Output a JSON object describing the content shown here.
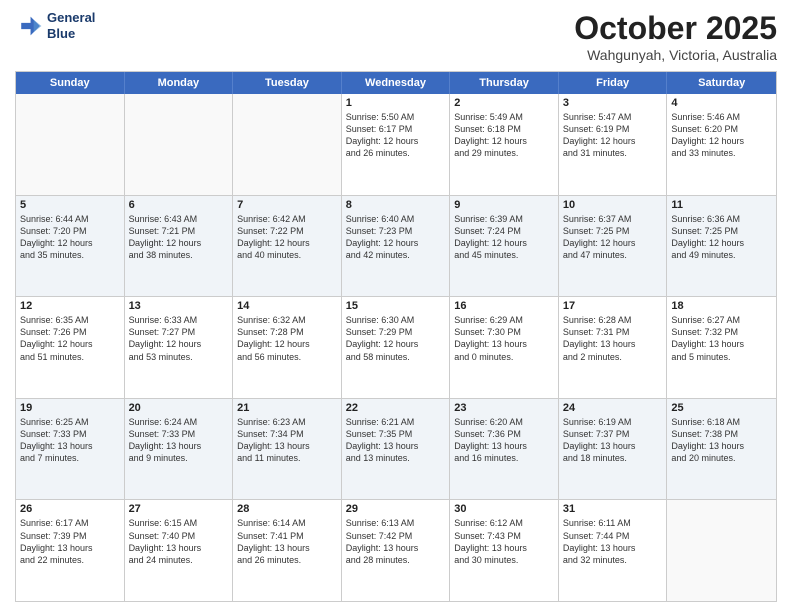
{
  "header": {
    "logo_line1": "General",
    "logo_line2": "Blue",
    "month": "October 2025",
    "location": "Wahgunyah, Victoria, Australia"
  },
  "day_headers": [
    "Sunday",
    "Monday",
    "Tuesday",
    "Wednesday",
    "Thursday",
    "Friday",
    "Saturday"
  ],
  "weeks": [
    {
      "alt": false,
      "days": [
        {
          "num": "",
          "info": ""
        },
        {
          "num": "",
          "info": ""
        },
        {
          "num": "",
          "info": ""
        },
        {
          "num": "1",
          "info": "Sunrise: 5:50 AM\nSunset: 6:17 PM\nDaylight: 12 hours\nand 26 minutes."
        },
        {
          "num": "2",
          "info": "Sunrise: 5:49 AM\nSunset: 6:18 PM\nDaylight: 12 hours\nand 29 minutes."
        },
        {
          "num": "3",
          "info": "Sunrise: 5:47 AM\nSunset: 6:19 PM\nDaylight: 12 hours\nand 31 minutes."
        },
        {
          "num": "4",
          "info": "Sunrise: 5:46 AM\nSunset: 6:20 PM\nDaylight: 12 hours\nand 33 minutes."
        }
      ]
    },
    {
      "alt": true,
      "days": [
        {
          "num": "5",
          "info": "Sunrise: 6:44 AM\nSunset: 7:20 PM\nDaylight: 12 hours\nand 35 minutes."
        },
        {
          "num": "6",
          "info": "Sunrise: 6:43 AM\nSunset: 7:21 PM\nDaylight: 12 hours\nand 38 minutes."
        },
        {
          "num": "7",
          "info": "Sunrise: 6:42 AM\nSunset: 7:22 PM\nDaylight: 12 hours\nand 40 minutes."
        },
        {
          "num": "8",
          "info": "Sunrise: 6:40 AM\nSunset: 7:23 PM\nDaylight: 12 hours\nand 42 minutes."
        },
        {
          "num": "9",
          "info": "Sunrise: 6:39 AM\nSunset: 7:24 PM\nDaylight: 12 hours\nand 45 minutes."
        },
        {
          "num": "10",
          "info": "Sunrise: 6:37 AM\nSunset: 7:25 PM\nDaylight: 12 hours\nand 47 minutes."
        },
        {
          "num": "11",
          "info": "Sunrise: 6:36 AM\nSunset: 7:25 PM\nDaylight: 12 hours\nand 49 minutes."
        }
      ]
    },
    {
      "alt": false,
      "days": [
        {
          "num": "12",
          "info": "Sunrise: 6:35 AM\nSunset: 7:26 PM\nDaylight: 12 hours\nand 51 minutes."
        },
        {
          "num": "13",
          "info": "Sunrise: 6:33 AM\nSunset: 7:27 PM\nDaylight: 12 hours\nand 53 minutes."
        },
        {
          "num": "14",
          "info": "Sunrise: 6:32 AM\nSunset: 7:28 PM\nDaylight: 12 hours\nand 56 minutes."
        },
        {
          "num": "15",
          "info": "Sunrise: 6:30 AM\nSunset: 7:29 PM\nDaylight: 12 hours\nand 58 minutes."
        },
        {
          "num": "16",
          "info": "Sunrise: 6:29 AM\nSunset: 7:30 PM\nDaylight: 13 hours\nand 0 minutes."
        },
        {
          "num": "17",
          "info": "Sunrise: 6:28 AM\nSunset: 7:31 PM\nDaylight: 13 hours\nand 2 minutes."
        },
        {
          "num": "18",
          "info": "Sunrise: 6:27 AM\nSunset: 7:32 PM\nDaylight: 13 hours\nand 5 minutes."
        }
      ]
    },
    {
      "alt": true,
      "days": [
        {
          "num": "19",
          "info": "Sunrise: 6:25 AM\nSunset: 7:33 PM\nDaylight: 13 hours\nand 7 minutes."
        },
        {
          "num": "20",
          "info": "Sunrise: 6:24 AM\nSunset: 7:33 PM\nDaylight: 13 hours\nand 9 minutes."
        },
        {
          "num": "21",
          "info": "Sunrise: 6:23 AM\nSunset: 7:34 PM\nDaylight: 13 hours\nand 11 minutes."
        },
        {
          "num": "22",
          "info": "Sunrise: 6:21 AM\nSunset: 7:35 PM\nDaylight: 13 hours\nand 13 minutes."
        },
        {
          "num": "23",
          "info": "Sunrise: 6:20 AM\nSunset: 7:36 PM\nDaylight: 13 hours\nand 16 minutes."
        },
        {
          "num": "24",
          "info": "Sunrise: 6:19 AM\nSunset: 7:37 PM\nDaylight: 13 hours\nand 18 minutes."
        },
        {
          "num": "25",
          "info": "Sunrise: 6:18 AM\nSunset: 7:38 PM\nDaylight: 13 hours\nand 20 minutes."
        }
      ]
    },
    {
      "alt": false,
      "days": [
        {
          "num": "26",
          "info": "Sunrise: 6:17 AM\nSunset: 7:39 PM\nDaylight: 13 hours\nand 22 minutes."
        },
        {
          "num": "27",
          "info": "Sunrise: 6:15 AM\nSunset: 7:40 PM\nDaylight: 13 hours\nand 24 minutes."
        },
        {
          "num": "28",
          "info": "Sunrise: 6:14 AM\nSunset: 7:41 PM\nDaylight: 13 hours\nand 26 minutes."
        },
        {
          "num": "29",
          "info": "Sunrise: 6:13 AM\nSunset: 7:42 PM\nDaylight: 13 hours\nand 28 minutes."
        },
        {
          "num": "30",
          "info": "Sunrise: 6:12 AM\nSunset: 7:43 PM\nDaylight: 13 hours\nand 30 minutes."
        },
        {
          "num": "31",
          "info": "Sunrise: 6:11 AM\nSunset: 7:44 PM\nDaylight: 13 hours\nand 32 minutes."
        },
        {
          "num": "",
          "info": ""
        }
      ]
    }
  ]
}
